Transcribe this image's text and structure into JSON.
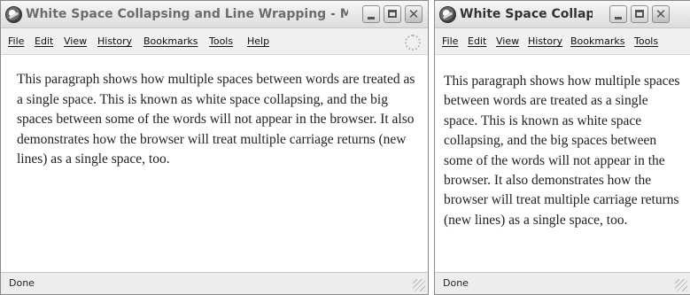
{
  "window_1": {
    "title": "White Space Collapsing and Line Wrapping - Mozi...",
    "menu": [
      "File",
      "Edit",
      "View",
      "History",
      "Bookmarks",
      "Tools",
      "Help"
    ],
    "paragraph": "This paragraph shows how multiple spaces between words are treated as a single space. This is known as white space collapsing, and the big spaces between some of the words will not appear in the browser. It also demonstrates how the browser will treat multiple carriage returns (new lines) as a single space, too.",
    "status": "Done",
    "icons": [
      "browser-icon",
      "minimize-icon",
      "maximize-icon",
      "close-icon",
      "throbber-icon",
      "resize-grip-icon"
    ]
  },
  "window_2": {
    "title": "White Space Collapsing ...",
    "menu": [
      "File",
      "Edit",
      "View",
      "History",
      "Bookmarks",
      "Tools"
    ],
    "paragraph": "This paragraph shows how multiple spaces between words are treated as a single space. This is known as white space collapsing, and the big spaces between some of the words will not appear in the browser. It also demonstrates how the browser will treat multiple carriage returns (new lines) as a single space, too.",
    "status": "Done",
    "icons": [
      "browser-icon",
      "minimize-icon",
      "maximize-icon",
      "close-icon",
      "resize-grip-icon"
    ]
  }
}
